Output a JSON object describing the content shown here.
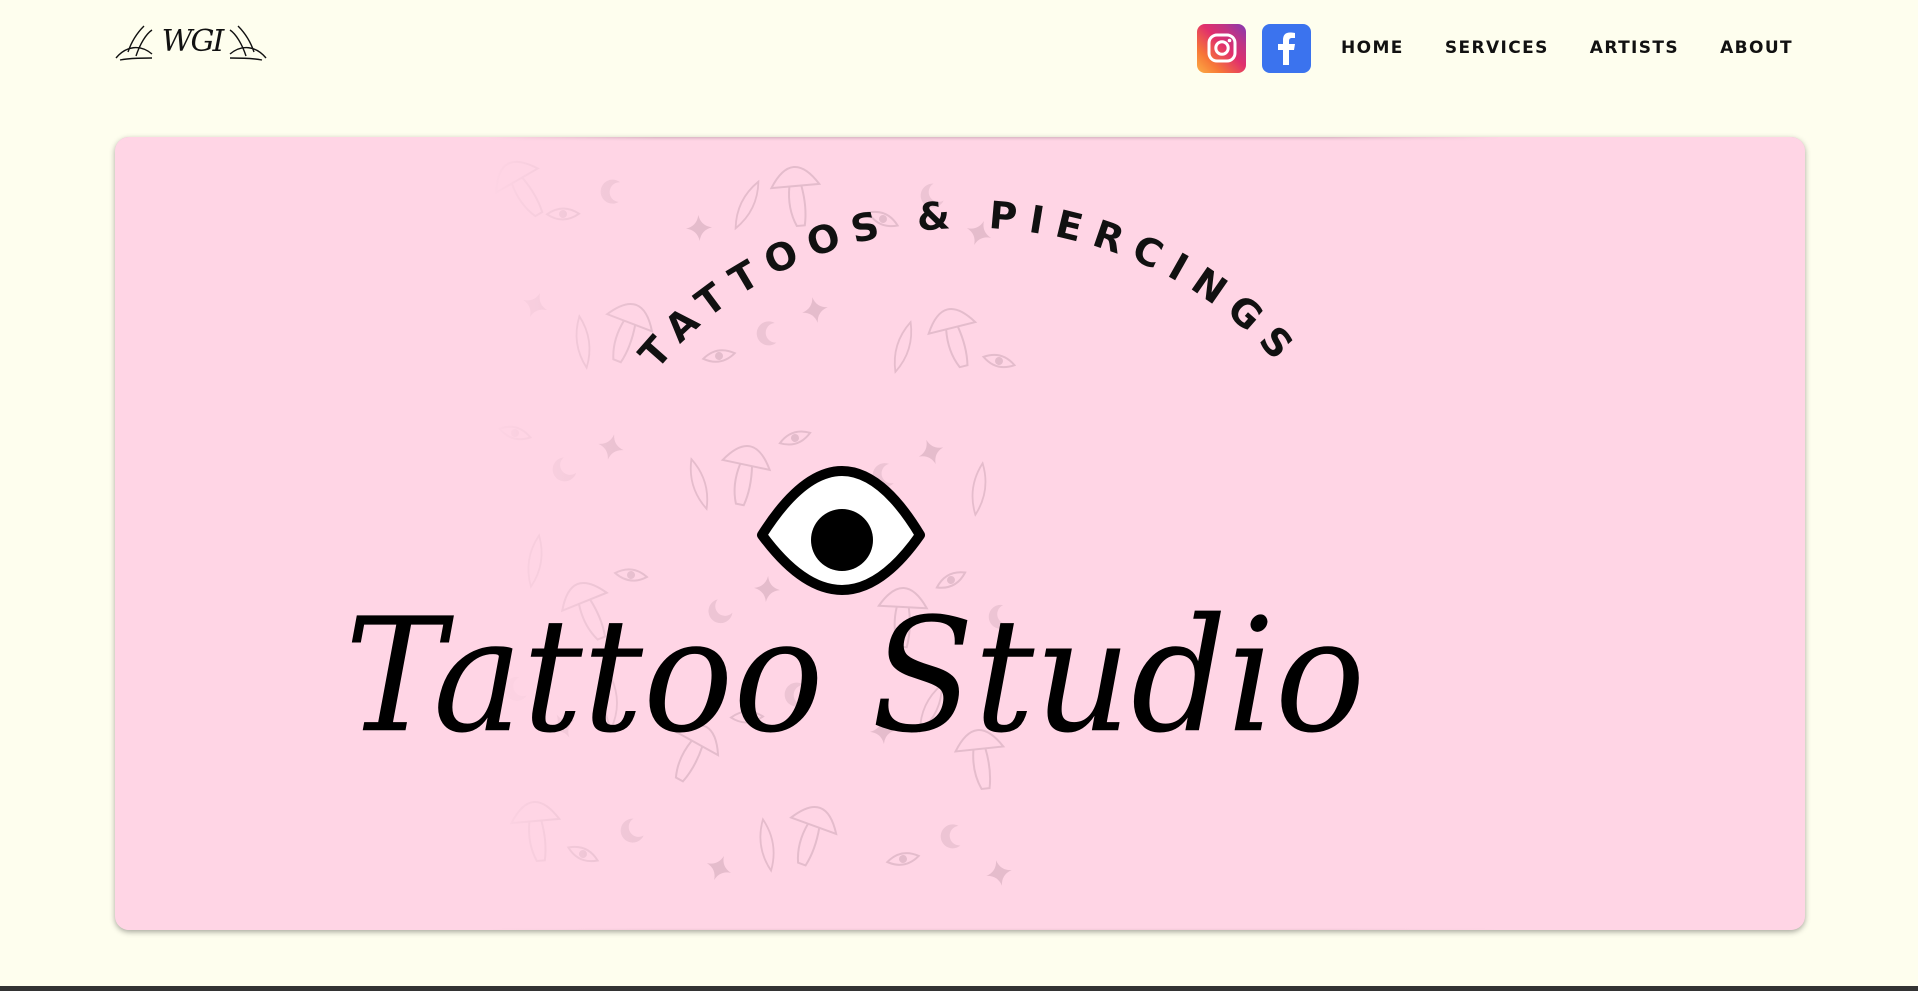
{
  "logo": {
    "text": "WGI"
  },
  "nav": {
    "social": [
      {
        "name": "instagram-icon",
        "color": "#e1306c"
      },
      {
        "name": "facebook-icon",
        "color": "#3b73ee"
      }
    ],
    "links": [
      "HOME",
      "SERVICES",
      "ARTISTS",
      "ABOUT"
    ]
  },
  "hero": {
    "arc_text": "TATTOOS & PIERCINGS",
    "script_title": "Tattoo Studio",
    "background_color": "#ffd5e5",
    "pattern_icons": [
      "mushroom-icon",
      "eye-icon",
      "moon-icon",
      "star-icon",
      "leaf-icon"
    ]
  },
  "colors": {
    "page_background": "#fefeee",
    "text": "#111111"
  }
}
